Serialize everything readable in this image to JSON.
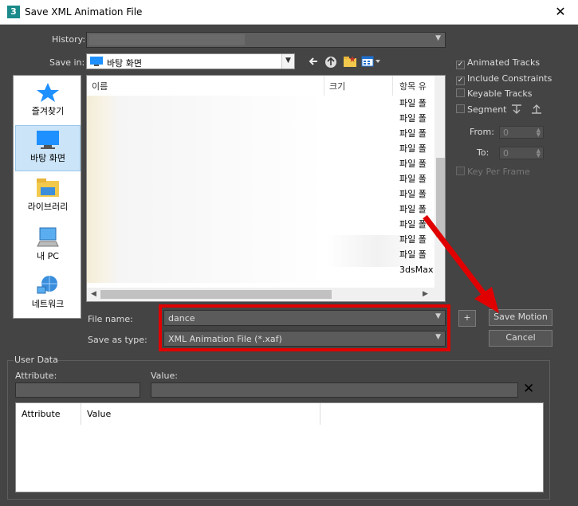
{
  "window": {
    "title": "Save XML Animation File",
    "app_icon_text": "3",
    "close_glyph": "✕"
  },
  "history": {
    "label": "History:",
    "value": ""
  },
  "save_in": {
    "label": "Save in:",
    "value": "바탕 화면"
  },
  "places": [
    {
      "label": "즐겨찾기",
      "icon": "star-icon"
    },
    {
      "label": "바탕 화면",
      "icon": "desktop-icon",
      "active": true
    },
    {
      "label": "라이브러리",
      "icon": "library-folder-icon"
    },
    {
      "label": "내 PC",
      "icon": "computer-icon"
    },
    {
      "label": "네트워크",
      "icon": "network-icon"
    }
  ],
  "filelist": {
    "columns": [
      "이름",
      "크기",
      "항목 유"
    ],
    "type_items": [
      "파일 폴",
      "파일 폴",
      "파일 폴",
      "파일 폴",
      "파일 폴",
      "파일 폴",
      "파일 폴",
      "파일 폴",
      "파일 폴",
      "파일 폴",
      "파일 폴",
      "3dsMax"
    ]
  },
  "file_name": {
    "label": "File name:",
    "value": "dance"
  },
  "save_as_type": {
    "label": "Save as type:",
    "value": "XML Animation File (*.xaf)"
  },
  "buttons": {
    "plus": "+",
    "save_motion": "Save Motion",
    "cancel": "Cancel"
  },
  "options": {
    "animated_tracks": {
      "label": "Animated Tracks",
      "checked": true
    },
    "include_constraints": {
      "label": "Include Constraints",
      "checked": true
    },
    "keyable_tracks": {
      "label": "Keyable Tracks",
      "checked": false
    },
    "segment": {
      "label": "Segment",
      "checked": false
    },
    "from": {
      "label": "From:",
      "value": "0"
    },
    "to": {
      "label": "To:",
      "value": "0"
    },
    "key_per_frame": {
      "label": "Key Per Frame",
      "checked": false
    }
  },
  "user_data": {
    "group_label": "User Data",
    "attribute_label": "Attribute:",
    "value_label": "Value:",
    "delete_glyph": "✕",
    "table_columns": [
      "Attribute",
      "Value"
    ]
  },
  "colors": {
    "highlight_red": "#e00000",
    "background": "#444444",
    "selection": "#cce4f7"
  }
}
